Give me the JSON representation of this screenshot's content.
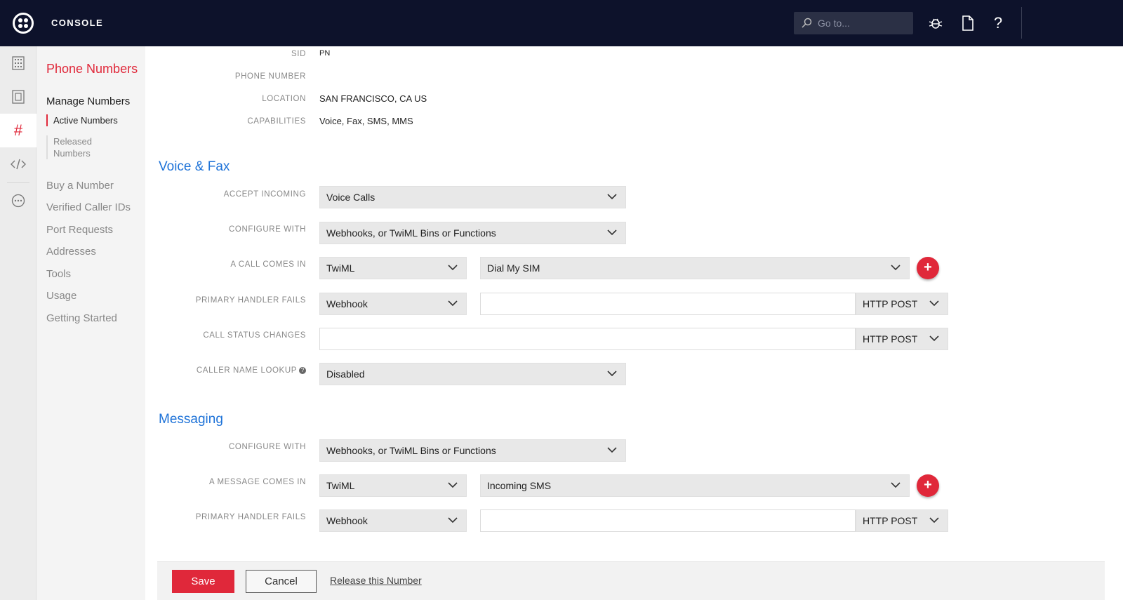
{
  "header": {
    "brand": "CONSOLE",
    "search_placeholder": "Go to...",
    "icons": [
      "debugger-bug-icon",
      "docs-icon",
      "help-icon"
    ]
  },
  "rail": {
    "items": [
      "dashboard-grid-icon",
      "document-icon",
      "hash-icon",
      "code-icon",
      "more-icon"
    ],
    "active": "hash-icon"
  },
  "sidenav": {
    "title": "Phone Numbers",
    "group": "Manage Numbers",
    "subitems": [
      {
        "label": "Active Numbers",
        "active": true
      },
      {
        "label": "Released Numbers",
        "active": false
      }
    ],
    "links": [
      "Buy a Number",
      "Verified Caller IDs",
      "Port Requests",
      "Addresses",
      "Tools",
      "Usage",
      "Getting Started"
    ]
  },
  "properties": {
    "sid_label": "SID",
    "sid_value": "PN",
    "phone_label": "PHONE NUMBER",
    "phone_value": "",
    "location_label": "LOCATION",
    "location_value": "SAN FRANCISCO, CA US",
    "capabilities_label": "CAPABILITIES",
    "capabilities_value": "Voice, Fax, SMS, MMS"
  },
  "voice": {
    "heading": "Voice & Fax",
    "accept_incoming_label": "ACCEPT INCOMING",
    "accept_incoming_value": "Voice Calls",
    "configure_label": "CONFIGURE WITH",
    "configure_value": "Webhooks, or TwiML Bins or Functions",
    "call_comes_in_label": "A CALL COMES IN",
    "call_type": "TwiML",
    "call_bin": "Dial My SIM",
    "primary_fails_label": "PRIMARY HANDLER FAILS",
    "primary_fails_type": "Webhook",
    "primary_fails_url": "",
    "primary_fails_method": "HTTP POST",
    "status_changes_label": "CALL STATUS CHANGES",
    "status_changes_url": "",
    "status_changes_method": "HTTP POST",
    "caller_lookup_label": "CALLER NAME LOOKUP",
    "caller_lookup_value": "Disabled"
  },
  "messaging": {
    "heading": "Messaging",
    "configure_label": "CONFIGURE WITH",
    "configure_value": "Webhooks, or TwiML Bins or Functions",
    "message_comes_in_label": "A MESSAGE COMES IN",
    "message_type": "TwiML",
    "message_bin": "Incoming SMS",
    "primary_fails_label": "PRIMARY HANDLER FAILS",
    "primary_fails_type": "Webhook",
    "primary_fails_url": "",
    "primary_fails_method": "HTTP POST"
  },
  "footer": {
    "save": "Save",
    "cancel": "Cancel",
    "release": "Release this Number"
  },
  "colors": {
    "accent": "#e0283a",
    "header_bg": "#0d122b",
    "link_blue": "#1f73d8"
  }
}
